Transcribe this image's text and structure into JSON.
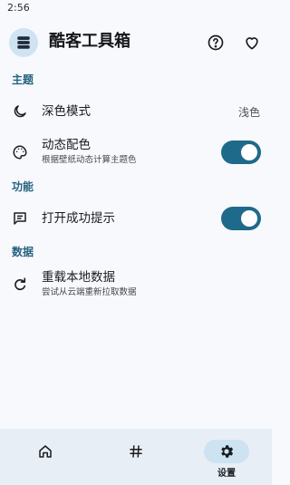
{
  "status_bar": {
    "time": "2:56"
  },
  "app": {
    "title": "酷客工具箱",
    "logo_icon": "stack-layers-icon",
    "help_icon": "help-circle-icon",
    "favorite_icon": "heart-outline-icon"
  },
  "sections": {
    "theme": "主题",
    "function": "功能",
    "data": "数据"
  },
  "settings": {
    "dark_mode": {
      "title": "深色模式",
      "value": "浅色",
      "icon": "moon-icon"
    },
    "dynamic_color": {
      "title": "动态配色",
      "subtitle": "根据壁纸动态计算主题色",
      "enabled": true,
      "icon": "palette-icon"
    },
    "success_tip": {
      "title": "打开成功提示",
      "enabled": true,
      "icon": "message-text-icon"
    },
    "reload_data": {
      "title": "重载本地数据",
      "subtitle": "尝试从云端重新拉取数据",
      "icon": "refresh-icon"
    }
  },
  "bottom_nav": {
    "items": [
      {
        "icon": "home-icon",
        "label": ""
      },
      {
        "icon": "hashtag-icon",
        "label": ""
      },
      {
        "icon": "gear-icon",
        "label": "设置",
        "active": true
      }
    ]
  },
  "colors": {
    "accent": "#1e6a8a",
    "section_header": "#26627f",
    "background": "#f7f9fd",
    "nav_background": "#e8eef6",
    "nav_active_pill": "#cde3f2"
  }
}
